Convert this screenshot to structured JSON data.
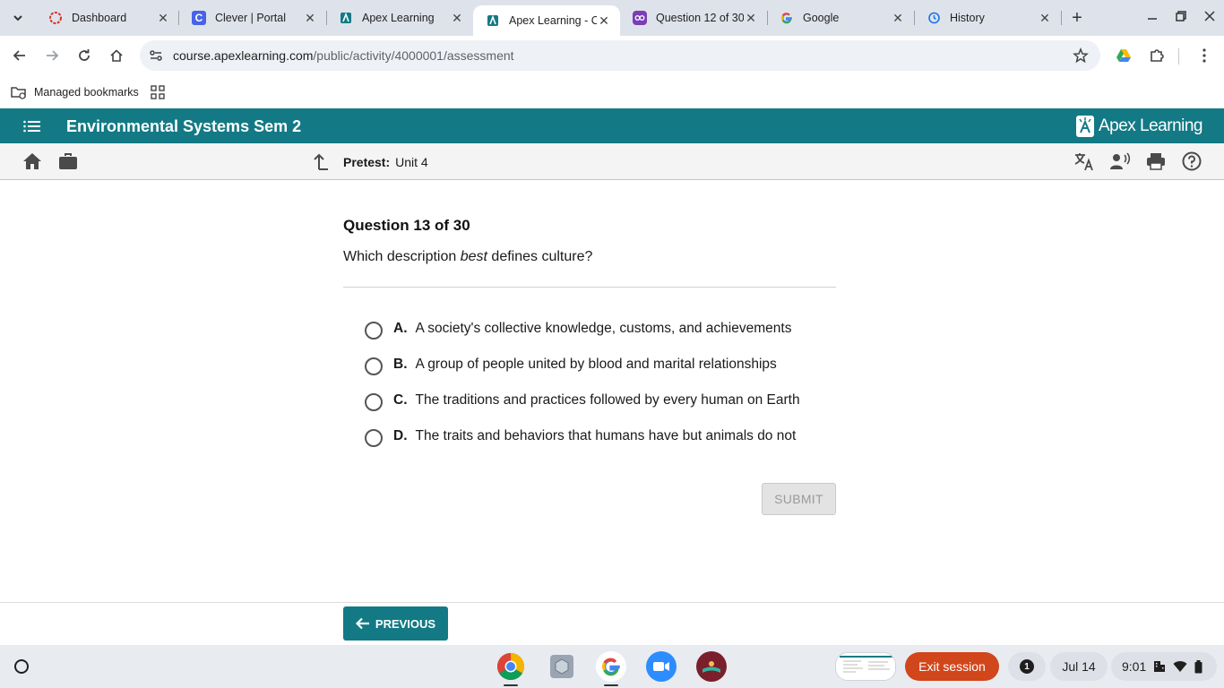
{
  "browser": {
    "tabs": [
      {
        "title": "Dashboard",
        "icon": "red-ring-icon",
        "active": false
      },
      {
        "title": "Clever | Portal",
        "icon": "clever-c-icon",
        "active": false
      },
      {
        "title": "Apex Learning",
        "icon": "apex-icon",
        "active": false
      },
      {
        "title": "Apex Learning - C",
        "icon": "apex-icon",
        "active": true
      },
      {
        "title": "Question 12 of 30",
        "icon": "owl-icon",
        "active": false
      },
      {
        "title": "Google",
        "icon": "google-g-icon",
        "active": false
      },
      {
        "title": "History",
        "icon": "history-icon",
        "active": false
      }
    ],
    "url_host": "course.apexlearning.com",
    "url_path": "/public/activity/4000001/assessment",
    "bookmarks": {
      "managed_label": "Managed bookmarks"
    }
  },
  "apex": {
    "course_title": "Environmental Systems Sem 2",
    "logo_text": "Apex Learning",
    "activity_type": "Pretest:",
    "activity_name": "Unit 4"
  },
  "question": {
    "number_label": "Question 13 of 30",
    "text_before": "Which description ",
    "text_emphasis": "best",
    "text_after": " defines culture?",
    "answers": [
      {
        "letter": "A.",
        "text": "A society's collective knowledge, customs, and achievements"
      },
      {
        "letter": "B.",
        "text": "A group of people united by blood and marital relationships"
      },
      {
        "letter": "C.",
        "text": "The traditions and practices followed by every human on Earth"
      },
      {
        "letter": "D.",
        "text": "The traits and behaviors that humans have but animals do not"
      }
    ],
    "submit_label": "SUBMIT"
  },
  "footer": {
    "previous_label": "PREVIOUS"
  },
  "shelf": {
    "exit_session_label": "Exit session",
    "notification_count": "1",
    "date": "Jul 14",
    "time": "9:01"
  },
  "colors": {
    "apex_teal": "#137a85",
    "exit_orange": "#d1461b",
    "tabstrip_bg": "#dee3eb"
  }
}
